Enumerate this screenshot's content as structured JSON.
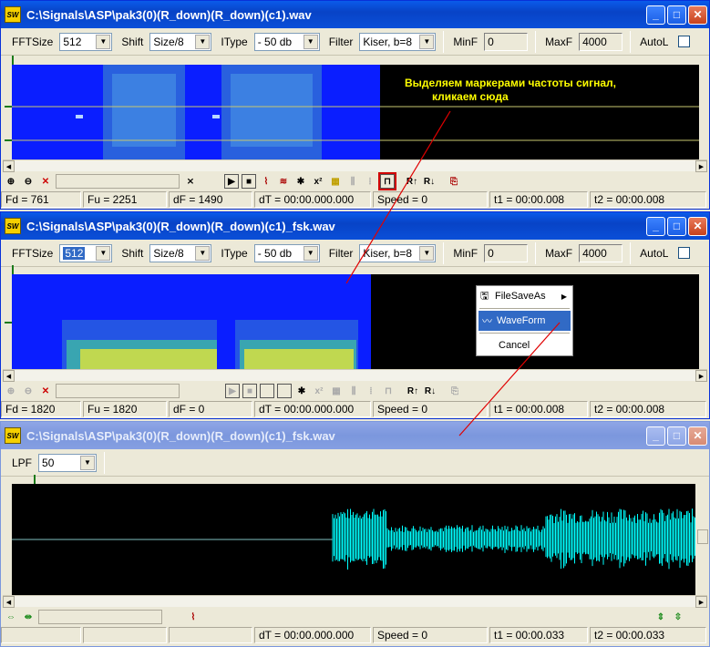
{
  "win1": {
    "title": "C:\\Signals\\ASP\\pak3(0)(R_down)(R_down)(c1).wav",
    "fftsize_label": "FFTSize",
    "fftsize_value": "512",
    "shift_label": "Shift",
    "shift_value": "Size/8",
    "itype_label": "IType",
    "itype_value": "- 50 db",
    "filter_label": "Filter",
    "filter_value": "Kiser, b=8",
    "minf_label": "MinF",
    "minf_value": "0",
    "maxf_label": "MaxF",
    "maxf_value": "4000",
    "autol_label": "AutoL",
    "annotation_line1": "Выделяем маркерами частоты сигнал,",
    "annotation_line2": "кликаем сюда",
    "status": {
      "fd": "Fd = 761",
      "fu": "Fu = 2251",
      "df": "dF = 1490",
      "dt": "dT = 00:00.000.000",
      "speed": "Speed = 0",
      "t1": "t1 = 00:00.008",
      "t2": "t2 = 00:00.008"
    }
  },
  "win2": {
    "title": "C:\\Signals\\ASP\\pak3(0)(R_down)(R_down)(c1)_fsk.wav",
    "fftsize_label": "FFTSize",
    "fftsize_value": "512",
    "shift_label": "Shift",
    "shift_value": "Size/8",
    "itype_label": "IType",
    "itype_value": "- 50 db",
    "filter_label": "Filter",
    "filter_value": "Kiser, b=8",
    "minf_label": "MinF",
    "minf_value": "0",
    "maxf_label": "MaxF",
    "maxf_value": "4000",
    "autol_label": "AutoL",
    "status": {
      "fd": "Fd = 1820",
      "fu": "Fu = 1820",
      "df": "dF = 0",
      "dt": "dT = 00:00.000.000",
      "speed": "Speed = 0",
      "t1": "t1 = 00:00.008",
      "t2": "t2 = 00:00.008"
    }
  },
  "context_menu": {
    "file_save_as": "FileSaveAs",
    "waveform": "WaveForm",
    "cancel": "Cancel"
  },
  "win3": {
    "title": "C:\\Signals\\ASP\\pak3(0)(R_down)(R_down)(c1)_fsk.wav",
    "lpf_label": "LPF",
    "lpf_value": "50",
    "status": {
      "dt": "dT = 00:00.000.000",
      "speed": "Speed = 0",
      "t1": "t1 = 00:00.033",
      "t2": "t2 = 00:00.033"
    }
  },
  "colors": {
    "spectrum_blue": "#0a1eff",
    "wave_cyan": "#00ffff",
    "annotation": "#ffff00",
    "arrow_red": "#e00000"
  }
}
